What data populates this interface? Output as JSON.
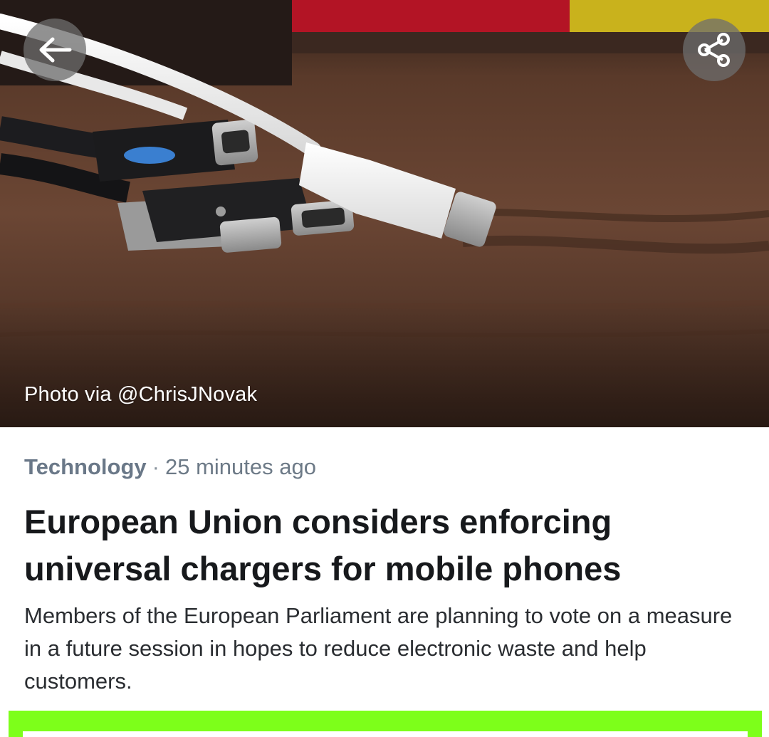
{
  "hero": {
    "photo_credit": "Photo via @ChrisJNovak",
    "back_button_icon": "arrow-left-icon",
    "share_button_icon": "share-icon"
  },
  "article": {
    "category": "Technology",
    "separator": "·",
    "time_ago": "25 minutes ago",
    "headline": "European Union considers enforcing universal chargers for mobile phones",
    "summary": "Members of the European Parliament are planning to vote on a measure in a future session in hopes to reduce electronic waste and help customers."
  },
  "colors": {
    "meta_text": "#6d7a87",
    "headline_text": "#17191c",
    "accent_green": "#7dff1a"
  }
}
